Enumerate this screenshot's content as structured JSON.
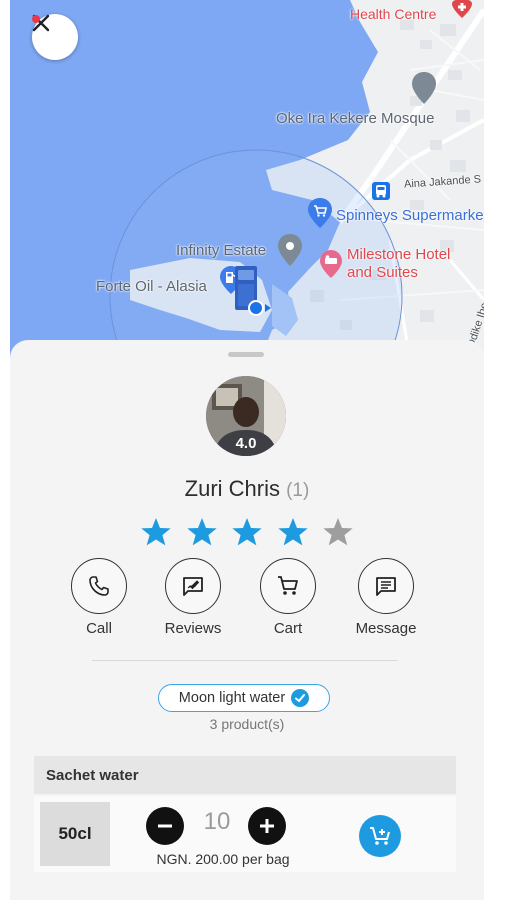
{
  "map": {
    "labels": {
      "health_centre": "Health Centre",
      "mosque": "Oke Ira Kekere Mosque",
      "street": "Aina Jakande S",
      "supermarket": "Spinneys Supermarke",
      "estate": "Infinity Estate",
      "hotel_line1": "Milestone Hotel",
      "hotel_line2": "and Suites",
      "fuel": "Forte Oil - Alasia",
      "road": "Odike Ibe"
    },
    "icons": [
      "close-icon",
      "mosque-pin-icon",
      "bus-stop-icon",
      "shopping-pin-icon",
      "location-pin-icon",
      "hotel-pin-icon",
      "fuel-pin-icon",
      "truck-icon",
      "current-location-dot-icon"
    ]
  },
  "vendor": {
    "rating": "4.0",
    "name": "Zuri Chris",
    "review_count": "(1)",
    "stars_filled": 4,
    "stars_total": 5
  },
  "actions": [
    {
      "label": "Call",
      "icon": "phone-icon"
    },
    {
      "label": "Reviews",
      "icon": "reviews-icon"
    },
    {
      "label": "Cart",
      "icon": "cart-icon"
    },
    {
      "label": "Message",
      "icon": "message-icon"
    }
  ],
  "store": {
    "name": "Moon light water",
    "products": "3 product(s)"
  },
  "section": {
    "title": "Sachet water"
  },
  "item": {
    "size": "50cl",
    "quantity": "10",
    "price": "NGN. 200.00 per bag"
  },
  "colors": {
    "accent": "#1e9be0",
    "star_filled": "#1e9be0",
    "star_empty": "#9e9e9e",
    "map_water": "#7fa8f4",
    "map_land": "#eef0f2"
  }
}
